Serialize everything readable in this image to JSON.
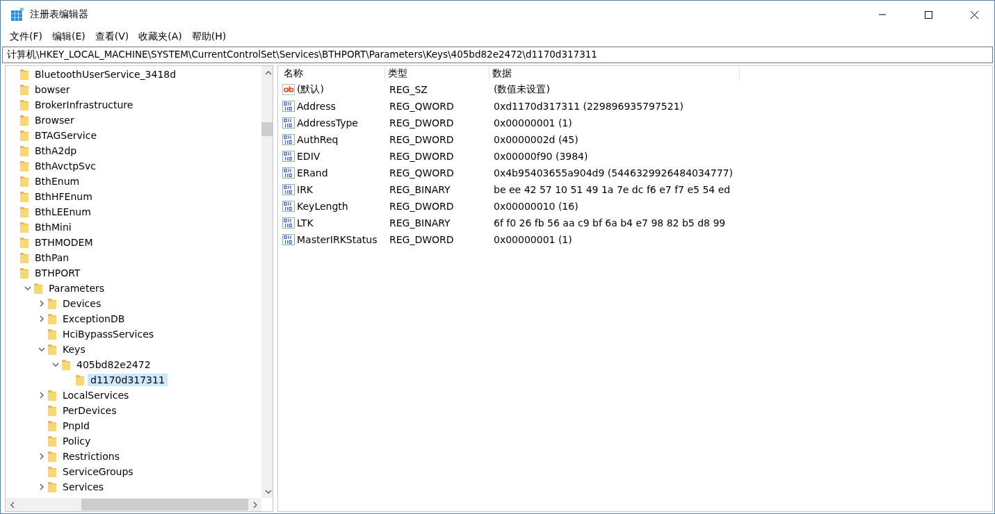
{
  "window": {
    "title": "注册表编辑器"
  },
  "menu": [
    "文件(F)",
    "编辑(E)",
    "查看(V)",
    "收藏夹(A)",
    "帮助(H)"
  ],
  "address": "计算机\\HKEY_LOCAL_MACHINE\\SYSTEM\\CurrentControlSet\\Services\\BTHPORT\\Parameters\\Keys\\405bd82e2472\\d1170d317311",
  "tree": [
    {
      "label": "BluetoothUserService_3418d",
      "selected": false
    },
    {
      "label": "bowser",
      "selected": false
    },
    {
      "label": "BrokerInfrastructure",
      "selected": false
    },
    {
      "label": "Browser",
      "selected": false
    },
    {
      "label": "BTAGService",
      "selected": false
    },
    {
      "label": "BthA2dp",
      "selected": false
    },
    {
      "label": "BthAvctpSvc",
      "selected": false
    },
    {
      "label": "BthEnum",
      "selected": false
    },
    {
      "label": "BthHFEnum",
      "selected": false
    },
    {
      "label": "BthLEEnum",
      "selected": false
    },
    {
      "label": "BthMini",
      "selected": false
    },
    {
      "label": "BTHMODEM",
      "selected": false
    },
    {
      "label": "BthPan",
      "selected": false
    },
    {
      "label": "BTHPORT",
      "selected": false,
      "children": [
        {
          "label": "Parameters",
          "expanded": true,
          "selected": false,
          "children": [
            {
              "label": "Devices",
              "expanded": false,
              "selected": false
            },
            {
              "label": "ExceptionDB",
              "expanded": false,
              "selected": false
            },
            {
              "label": "HciBypassServices",
              "selected": false
            },
            {
              "label": "Keys",
              "expanded": true,
              "selected": false,
              "children": [
                {
                  "label": "405bd82e2472",
                  "expanded": true,
                  "selected": false,
                  "children": [
                    {
                      "label": "d1170d317311",
                      "selected": true
                    }
                  ]
                }
              ]
            },
            {
              "label": "LocalServices",
              "expanded": false,
              "selected": false
            },
            {
              "label": "PerDevices",
              "selected": false
            },
            {
              "label": "PnpId",
              "selected": false
            },
            {
              "label": "Policy",
              "selected": false
            },
            {
              "label": "Restrictions",
              "expanded": false,
              "selected": false
            },
            {
              "label": "ServiceGroups",
              "selected": false
            },
            {
              "label": "Services",
              "expanded": false,
              "selected": false
            }
          ]
        }
      ]
    }
  ],
  "table": {
    "columns": [
      "名称",
      "类型",
      "数据"
    ],
    "rows": [
      {
        "kind": "string",
        "name": "(默认)",
        "type": "REG_SZ",
        "data": "(数值未设置)"
      },
      {
        "kind": "binary",
        "name": "Address",
        "type": "REG_QWORD",
        "data": "0xd1170d317311 (229896935797521)"
      },
      {
        "kind": "binary",
        "name": "AddressType",
        "type": "REG_DWORD",
        "data": "0x00000001 (1)"
      },
      {
        "kind": "binary",
        "name": "AuthReq",
        "type": "REG_DWORD",
        "data": "0x0000002d (45)"
      },
      {
        "kind": "binary",
        "name": "EDIV",
        "type": "REG_DWORD",
        "data": "0x00000f90 (3984)"
      },
      {
        "kind": "binary",
        "name": "ERand",
        "type": "REG_QWORD",
        "data": "0x4b95403655a904d9 (5446329926484034777)"
      },
      {
        "kind": "binary",
        "name": "IRK",
        "type": "REG_BINARY",
        "data": "be ee 42 57 10 51 49 1a 7e dc f6 e7 f7 e5 54 ed"
      },
      {
        "kind": "binary",
        "name": "KeyLength",
        "type": "REG_DWORD",
        "data": "0x00000010 (16)"
      },
      {
        "kind": "binary",
        "name": "LTK",
        "type": "REG_BINARY",
        "data": "6f f0 26 fb 56 aa c9 bf 6a b4 e7 98 82 b5 d8 99"
      },
      {
        "kind": "binary",
        "name": "MasterIRKStatus",
        "type": "REG_DWORD",
        "data": "0x00000001 (1)"
      }
    ]
  }
}
